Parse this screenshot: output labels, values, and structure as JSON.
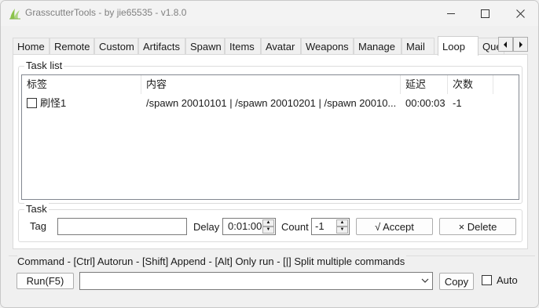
{
  "window": {
    "title": "GrasscutterTools  - by jie65535  - v1.8.0"
  },
  "tabs": [
    {
      "label": "Home"
    },
    {
      "label": "Remote"
    },
    {
      "label": "Custom"
    },
    {
      "label": "Artifacts"
    },
    {
      "label": "Spawn"
    },
    {
      "label": "Items"
    },
    {
      "label": "Avatar"
    },
    {
      "label": "Weapons"
    },
    {
      "label": "Manage"
    },
    {
      "label": "Mail"
    },
    {
      "label": "Loop"
    },
    {
      "label": "Que"
    }
  ],
  "active_tab": "Loop",
  "task_list": {
    "title": "Task list",
    "columns": [
      "标签",
      "内容",
      "延迟",
      "次数"
    ],
    "rows": [
      {
        "checked": false,
        "tag": "刷怪1",
        "content": "/spawn 20010101 | /spawn 20010201 | /spawn 20010...",
        "delay": "00:00:03",
        "count": "-1"
      }
    ]
  },
  "task": {
    "title": "Task",
    "tag_label": "Tag",
    "tag_value": "",
    "delay_label": "Delay",
    "delay_value": "0:01:00",
    "count_label": "Count",
    "count_value": "-1",
    "accept_label": "√ Accept",
    "delete_label": "× Delete"
  },
  "command": {
    "title": "Command   - [Ctrl] Autorun  - [Shift] Append  - [Alt] Only run  - [|] Split multiple commands",
    "run_label": "Run(F5)",
    "input_value": "",
    "copy_label": "Copy",
    "auto_label": "Auto",
    "auto_checked": false
  },
  "colors": {
    "window_bg": "#f0f0f0",
    "panel_bg": "#ffffff",
    "border": "#adadad"
  }
}
